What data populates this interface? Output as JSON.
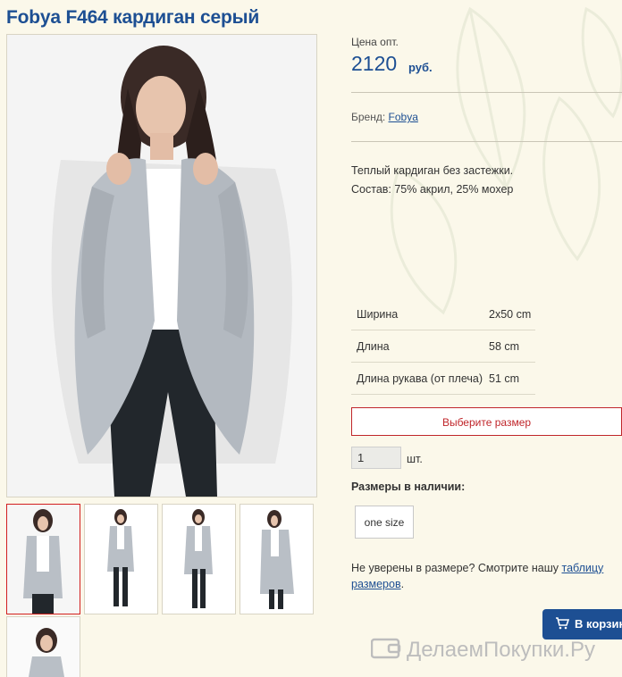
{
  "product": {
    "title": "Fobya F464 кардиган серый",
    "price_label": "Цена опт.",
    "price": "2120",
    "currency": "руб.",
    "brand_label": "Бренд:",
    "brand_name": "Fobya",
    "description_line1": "Теплый кардиган без застежки.",
    "description_line2": "Состав: 75% акрил, 25% мохер"
  },
  "specs": [
    {
      "name": "Ширина",
      "value": "2x50 cm"
    },
    {
      "name": "Длина",
      "value": "58 cm"
    },
    {
      "name": "Длина рукава (от плеча)",
      "value": "51 cm"
    }
  ],
  "purchase": {
    "choose_size_label": "Выберите размер",
    "quantity_value": "1",
    "quantity_unit": "шт.",
    "sizes_title": "Размеры в наличии:",
    "sizes": [
      "one size"
    ],
    "hint_text": "Не уверены в размере? Смотрите нашу ",
    "hint_link": "таблицу размеров",
    "hint_end": ".",
    "add_to_cart_label": "В корзину"
  },
  "watermark": "ДелаемПокупки.Ру",
  "colors": {
    "accent": "#1d4f93",
    "alert": "#c0262b",
    "background": "#fbf8ea"
  }
}
